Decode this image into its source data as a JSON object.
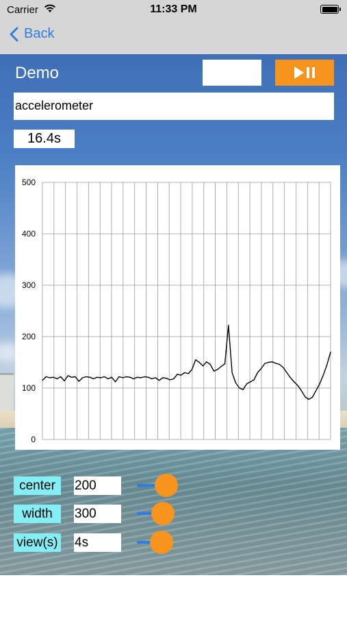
{
  "status_bar": {
    "carrier": "Carrier",
    "time": "11:33 PM",
    "wifi_icon": "wifi-icon",
    "battery_icon": "battery-icon"
  },
  "nav": {
    "back_label": "Back",
    "back_icon": "chevron-left-icon"
  },
  "header": {
    "title": "Demo",
    "blank_field": "",
    "play_pause_icon": "play-pause-icon"
  },
  "sensor": {
    "name": "accelerometer"
  },
  "elapsed": "16.4s",
  "chart_data": {
    "type": "line",
    "ylim": [
      0,
      500
    ],
    "yticks": [
      "0",
      "100",
      "200",
      "300",
      "400",
      "500"
    ],
    "grid": true,
    "vertical_gridlines": 25,
    "x": [
      0,
      1,
      2,
      3,
      4,
      5,
      6,
      7,
      8,
      9,
      10,
      11,
      12,
      13,
      14,
      15,
      16,
      17,
      18,
      19,
      20,
      21,
      22,
      23,
      24,
      25,
      26,
      27,
      28,
      29,
      30,
      31,
      32,
      33,
      34,
      35,
      36,
      37,
      38,
      39,
      40,
      41,
      42,
      43,
      44,
      45,
      46,
      47,
      48,
      49,
      50,
      51,
      52,
      53,
      54,
      55,
      56,
      57,
      58,
      59,
      60,
      61,
      62,
      63,
      64,
      65,
      66,
      67,
      68,
      69,
      70,
      71,
      72,
      73,
      74,
      75,
      76,
      77,
      78,
      79
    ],
    "values": [
      115,
      122,
      120,
      121,
      118,
      122,
      114,
      124,
      121,
      122,
      113,
      120,
      122,
      121,
      118,
      121,
      120,
      122,
      118,
      121,
      112,
      122,
      120,
      122,
      121,
      118,
      121,
      120,
      122,
      121,
      118,
      120,
      115,
      120,
      119,
      116,
      118,
      127,
      125,
      130,
      128,
      136,
      155,
      150,
      143,
      151,
      146,
      133,
      136,
      142,
      147,
      222,
      130,
      110,
      100,
      97,
      108,
      112,
      116,
      130,
      138,
      148,
      150,
      151,
      148,
      146,
      140,
      130,
      120,
      112,
      105,
      95,
      83,
      78,
      82,
      95,
      108,
      125,
      145,
      170
    ],
    "line_color": "#000000"
  },
  "controls": [
    {
      "label": "center",
      "value": "200",
      "slider_fraction": 0.4
    },
    {
      "label": "width",
      "value": "300",
      "slider_fraction": 0.3
    },
    {
      "label": "view(s)",
      "value": "4s",
      "slider_fraction": 0.25
    }
  ],
  "colors": {
    "accent_orange": "#f7941d",
    "label_cyan": "#84eef5",
    "link_blue": "#2f7de1",
    "slider_blue": "#2c7de6"
  }
}
